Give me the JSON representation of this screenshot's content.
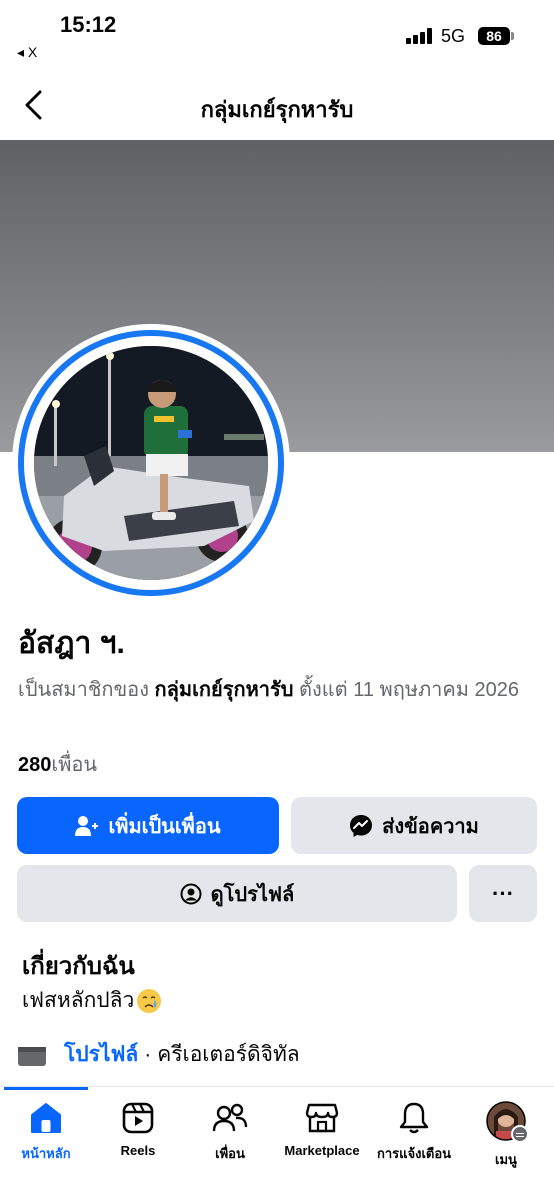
{
  "status_bar": {
    "time": "15:12",
    "back_app": "◂ X",
    "network": "5G",
    "battery": "86"
  },
  "header": {
    "title": "กลุ่มเกย์รุกหารับ"
  },
  "profile": {
    "name": "อัสฎา ฯ.",
    "member_prefix": "เป็นสมาชิกของ",
    "group_name": "กลุ่มเกย์รุกหารับ",
    "member_suffix": "ตั้งแต่ 11 พฤษภาคม 2026",
    "friends_count": "280",
    "friends_label": "เพื่อน"
  },
  "actions": {
    "add_friend": "เพิ่มเป็นเพื่อน",
    "message": "ส่งข้อความ",
    "view_profile": "ดูโปรไฟล์",
    "more": "···"
  },
  "about": {
    "title": "เกี่ยวกับฉัน",
    "bio": "เฟสหลักปลิว",
    "profile_link": "โปรไฟล์",
    "separator": "·",
    "category": "ครีเอเตอร์ดิจิทัล"
  },
  "tabs": [
    {
      "label": "หน้าหลัก",
      "icon": "home-icon",
      "active": true
    },
    {
      "label": "Reels",
      "icon": "reels-icon",
      "active": false
    },
    {
      "label": "เพื่อน",
      "icon": "friends-icon",
      "active": false
    },
    {
      "label": "Marketplace",
      "icon": "marketplace-icon",
      "active": false
    },
    {
      "label": "การแจ้งเตือน",
      "icon": "bell-icon",
      "active": false
    },
    {
      "label": "เมนู",
      "icon": "menu-avatar",
      "active": false
    }
  ],
  "colors": {
    "accent": "#0866ff",
    "ring": "#1877f2",
    "button_gray": "#e4e6eb",
    "secondary_text": "#65676b"
  }
}
